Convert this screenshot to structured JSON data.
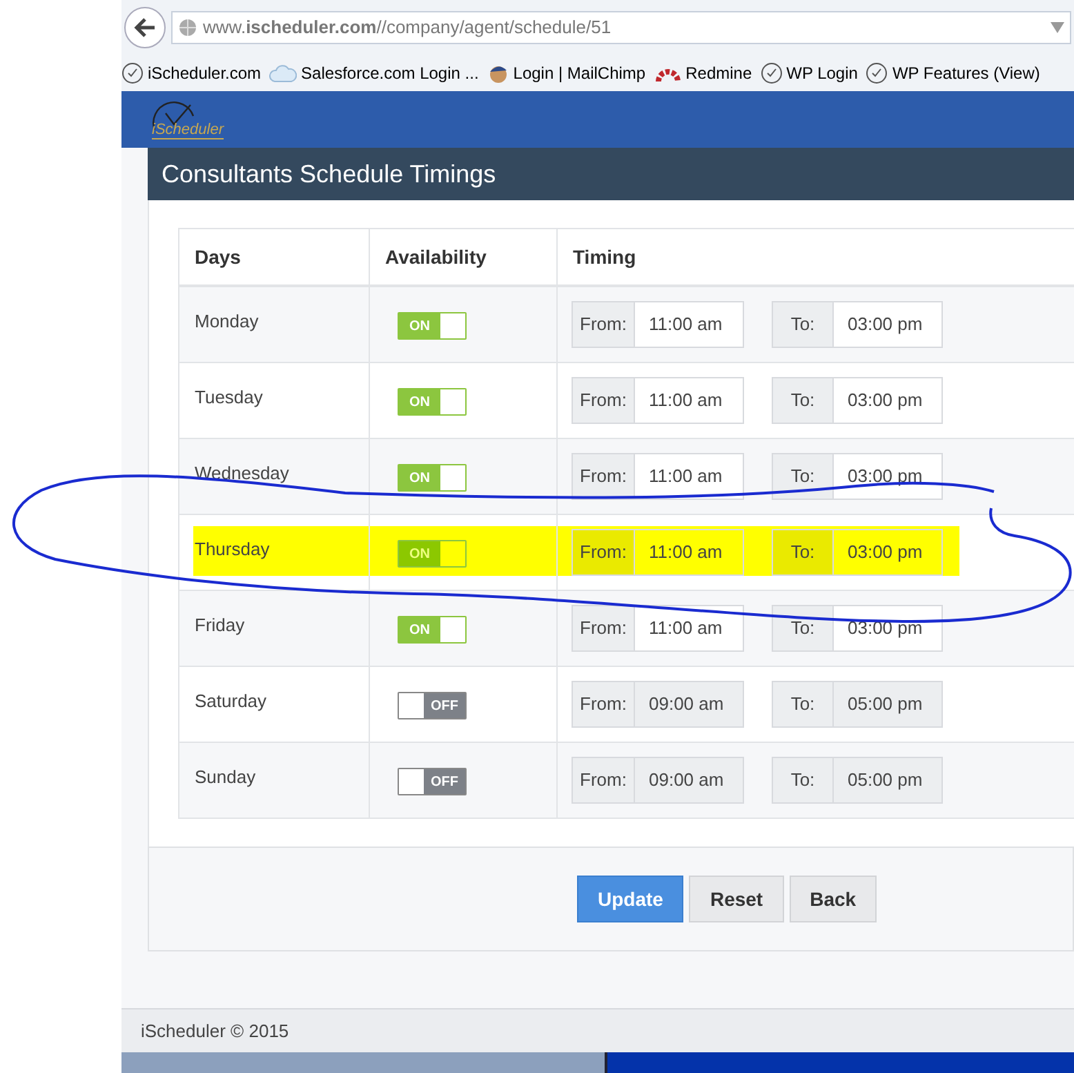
{
  "browser": {
    "url": "www.**ischeduler.com**//company/agent/schedule/51",
    "bookmarks": [
      {
        "label": "iScheduler.com",
        "kind": "clock"
      },
      {
        "label": "Salesforce.com Login ...",
        "kind": "cloud"
      },
      {
        "label": "Login | MailChimp",
        "kind": "monkey"
      },
      {
        "label": "Redmine",
        "kind": "arc"
      },
      {
        "label": "WP Login",
        "kind": "clock"
      },
      {
        "label": "WP Features (View)",
        "kind": "clock"
      }
    ]
  },
  "header": {
    "logo": "iScheduler"
  },
  "page_title": "Consultants Schedule Timings",
  "table": {
    "columns": [
      "Days",
      "Availability",
      "Timing"
    ],
    "rows": [
      {
        "day": "Monday",
        "on": true,
        "on_label": "ON",
        "from_label": "From:",
        "from": "11:00 am",
        "to_label": "To:",
        "to": "03:00 pm",
        "highlighted": false
      },
      {
        "day": "Tuesday",
        "on": true,
        "on_label": "ON",
        "from_label": "From:",
        "from": "11:00 am",
        "to_label": "To:",
        "to": "03:00 pm",
        "highlighted": false
      },
      {
        "day": "Wednesday",
        "on": true,
        "on_label": "ON",
        "from_label": "From:",
        "from": "11:00 am",
        "to_label": "To:",
        "to": "03:00 pm",
        "highlighted": false
      },
      {
        "day": "Thursday",
        "on": true,
        "on_label": "ON",
        "from_label": "From:",
        "from": "11:00 am",
        "to_label": "To:",
        "to": "03:00 pm",
        "highlighted": true
      },
      {
        "day": "Friday",
        "on": true,
        "on_label": "ON",
        "from_label": "From:",
        "from": "11:00 am",
        "to_label": "To:",
        "to": "03:00 pm",
        "highlighted": false
      },
      {
        "day": "Saturday",
        "on": false,
        "on_label": "OFF",
        "from_label": "From:",
        "from": "09:00 am",
        "to_label": "To:",
        "to": "05:00 pm",
        "highlighted": false
      },
      {
        "day": "Sunday",
        "on": false,
        "on_label": "OFF",
        "from_label": "From:",
        "from": "09:00 am",
        "to_label": "To:",
        "to": "05:00 pm",
        "highlighted": false
      }
    ]
  },
  "buttons": [
    {
      "label": "Update",
      "kind": "primary"
    },
    {
      "label": "Reset",
      "kind": "default"
    },
    {
      "label": "Back",
      "kind": "default"
    }
  ],
  "footer": "iScheduler © 2015"
}
